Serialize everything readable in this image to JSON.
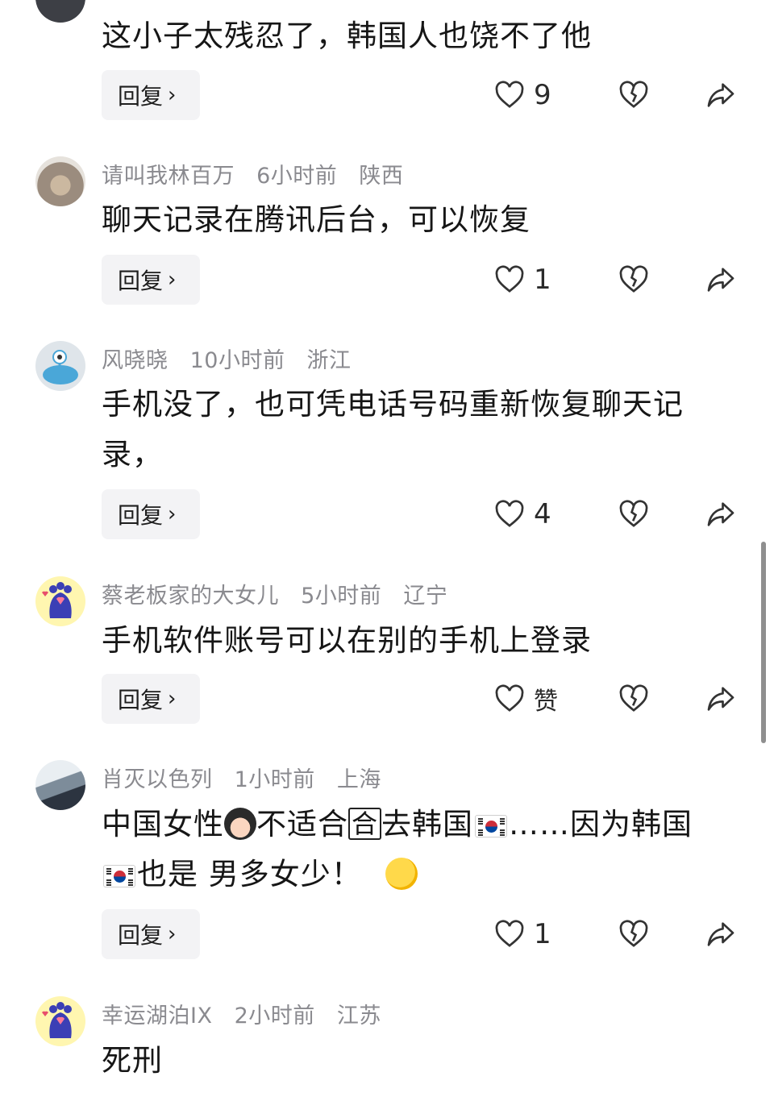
{
  "comments": [
    {
      "username": "",
      "time": "",
      "location": "",
      "text": "这小子太残忍了，韩国人也饶不了他",
      "reply_label": "回复",
      "likes": "9"
    },
    {
      "username": "请叫我林百万",
      "time": "6小时前",
      "location": "陕西",
      "text": "聊天记录在腾讯后台，可以恢复",
      "reply_label": "回复",
      "likes": "1"
    },
    {
      "username": "风晓晓",
      "time": "10小时前",
      "location": "浙江",
      "text": "手机没了，也可凭电话号码重新恢复聊天记录，",
      "reply_label": "回复",
      "likes": "4"
    },
    {
      "username": "蔡老板家的大女儿",
      "time": "5小时前",
      "location": "辽宁",
      "text": "手机软件账号可以在别的手机上登录",
      "reply_label": "回复",
      "likes": "赞"
    },
    {
      "username": "肖灭以色列",
      "time": "1小时前",
      "location": "上海",
      "text_parts": [
        "中国女性",
        "不适合",
        "合",
        "去韩国",
        "……因为韩国",
        "也是 男多女少！"
      ],
      "reply_label": "回复",
      "likes": "1"
    },
    {
      "username": "幸运湖泊IX",
      "time": "2小时前",
      "location": "江苏",
      "text": "死刑"
    }
  ],
  "icons": {
    "like": "heart-outline-icon",
    "dislike": "broken-heart-icon",
    "share": "share-arrow-icon",
    "reply_chevron": "chevron-right-icon"
  },
  "colors": {
    "meta_text": "#8a8a8f",
    "reply_bg": "#f3f3f5",
    "body_text": "#161616"
  }
}
